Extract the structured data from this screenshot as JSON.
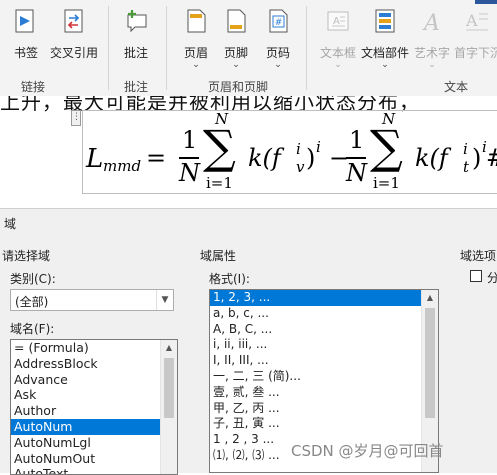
{
  "ribbon": {
    "buttons": [
      {
        "label": "书签",
        "icon": "bookmark-icon"
      },
      {
        "label": "交叉引用",
        "icon": "cross-reference-icon"
      },
      {
        "label": "批注",
        "icon": "comment-icon"
      },
      {
        "label": "页眉",
        "icon": "header-icon"
      },
      {
        "label": "页脚",
        "icon": "footer-icon"
      },
      {
        "label": "页码",
        "icon": "page-number-icon"
      },
      {
        "label": "文本框",
        "icon": "textbox-icon",
        "disabled": true
      },
      {
        "label": "文档部件",
        "icon": "quick-parts-icon"
      },
      {
        "label": "艺术字",
        "icon": "wordart-icon",
        "disabled": true
      },
      {
        "label": "首字下沉",
        "icon": "drop-cap-icon",
        "disabled": true
      }
    ],
    "groups": [
      "链接",
      "批注",
      "页眉和页脚",
      "文本"
    ]
  },
  "document": {
    "text_line": "上升，最大可能是并被利用以缩小状态分布，",
    "equation": {
      "lhs": "L",
      "lhs_sub": "mmd",
      "equals": "=",
      "num": "1",
      "den": "N",
      "sum_top": "N",
      "sum_bottom": "i=1",
      "term1": "k(f",
      "term1_sup": "i",
      "term1_sub": "v",
      "term1_close": ")",
      "power": "i",
      "minus": "−",
      "term2": "k(f",
      "term2_sup": "i",
      "term2_sub": "t",
      "term2_close": ")",
      "power2": "i",
      "hash": "#",
      "sigma": "∑"
    }
  },
  "dialog": {
    "title": "域",
    "choose_field": "请选择域",
    "category_label": "类别(C):",
    "category_value": "(全部)",
    "field_names_label": "域名(F):",
    "field_names": [
      "= (Formula)",
      "AddressBlock",
      "Advance",
      "Ask",
      "Author",
      "AutoNum",
      "AutoNumLgl",
      "AutoNumOut",
      "AutoText"
    ],
    "selected_field": "AutoNum",
    "field_properties": "域属性",
    "format_label": "格式(I):",
    "formats": [
      "1, 2, 3, ...",
      "a, b, c, ...",
      "A, B, C, ...",
      "i, ii, iii, ...",
      "I, II, III, ...",
      "一, 二, 三 (简)...",
      "壹, 贰, 叁 ...",
      "甲, 乙, 丙 ...",
      "子, 丑, 寅 ...",
      "1 , 2 , 3 ...",
      "⑴, ⑵, ⑶ ..."
    ],
    "selected_format": "1, 2, 3, ...",
    "field_options": "域选项",
    "option_partial": "分"
  },
  "watermark": "CSDN @岁月@可回首"
}
